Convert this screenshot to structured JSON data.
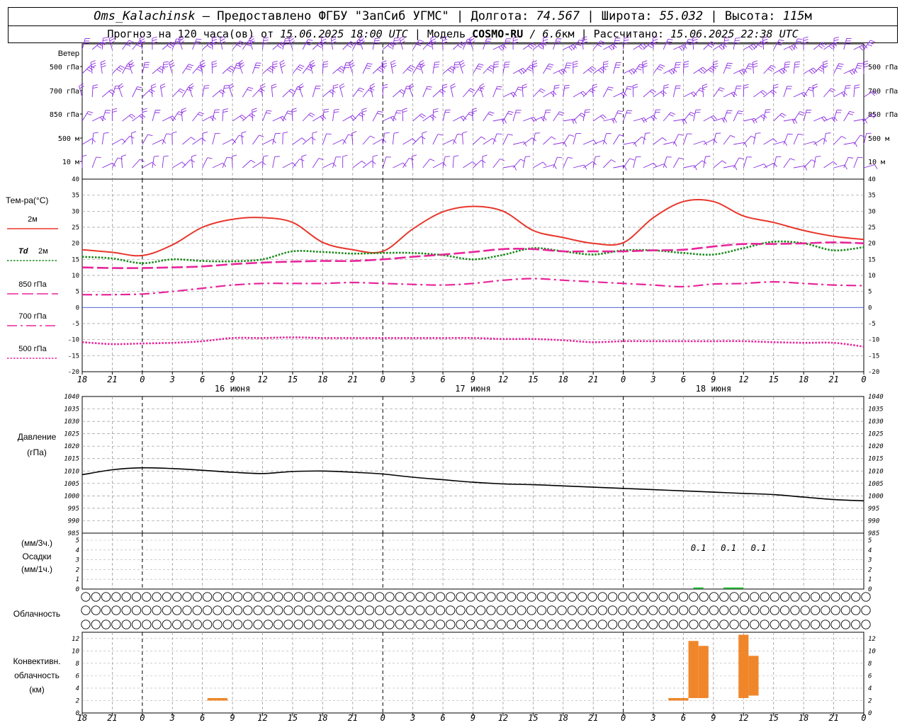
{
  "header": {
    "station": "Oms_Kalachinsk",
    "dash": " – ",
    "provider": "Предоставлено ФГБУ \"ЗапСиб УГМС\"",
    "sep": " | ",
    "lon_label": "Долгота:",
    "lon_value": "74.567",
    "lat_label": "Широта:",
    "lat_value": "55.032",
    "alt_label": "Высота:",
    "alt_value": "115",
    "alt_unit": "м",
    "forecast_prefix": "Прогноз на 120 часа(ов) от ",
    "forecast_from": "15.06.2025 18:00 UTC",
    "model_label": "| Модель ",
    "model_name": "COSMO-RU",
    "model_res": " / 6.6",
    "model_res_unit": "км",
    "calc_label": " | Рассчитано: ",
    "calc_time": "15.06.2025 22:38 UTC"
  },
  "chart_data": [
    {
      "type": "barbs",
      "title": "Ветер",
      "levels": [
        "500 гПа",
        "700 гПа",
        "850 гПа",
        "500 м",
        "10 м"
      ],
      "colors": {
        "barb": "#8a2be2"
      }
    },
    {
      "type": "line",
      "title": "Тем-ра(°C)",
      "ylim": [
        -20,
        40
      ],
      "yticks": [
        -20,
        -15,
        -10,
        -5,
        0,
        5,
        10,
        15,
        20,
        25,
        30,
        35,
        40
      ],
      "x_ticks": [
        "18",
        "21",
        "0",
        "3",
        "6",
        "9",
        "12",
        "15",
        "18",
        "21",
        "0",
        "3",
        "6",
        "9",
        "12",
        "15",
        "18",
        "21",
        "0",
        "3",
        "6",
        "9",
        "12",
        "15",
        "18",
        "21",
        "0"
      ],
      "day_labels": [
        "16 июня",
        "17 июня",
        "18 июня"
      ],
      "x_hours": [
        0,
        3,
        6,
        9,
        12,
        15,
        18,
        21,
        24,
        27,
        30,
        33,
        36,
        39,
        42,
        45,
        48,
        51,
        54,
        57,
        60,
        63,
        66,
        69,
        72,
        75,
        78
      ],
      "series": [
        {
          "name": "2м",
          "color": "#e8362b",
          "dash": "solid",
          "values": [
            18,
            17.2,
            16.2,
            19.5,
            25,
            27.5,
            28,
            26.5,
            20.3,
            18,
            17.5,
            24.5,
            29.8,
            31.5,
            30,
            24,
            21.8,
            20,
            20.2,
            28,
            33,
            33,
            28.5,
            26.5,
            24,
            22.2,
            21.2
          ]
        },
        {
          "name": "Td 2м",
          "color": "#1a8a1a",
          "dash": "dotted",
          "values": [
            15.8,
            15.3,
            13.8,
            15,
            14.5,
            14.4,
            15,
            17.5,
            17.3,
            16.8,
            17,
            17,
            16.3,
            15,
            16.4,
            18.5,
            17.5,
            16.5,
            17.8,
            17.8,
            17,
            16.5,
            18.5,
            20.5,
            20,
            17.8,
            18.8
          ]
        },
        {
          "name": "850 гПа",
          "color": "#e8259b",
          "dash": "longdash",
          "values": [
            12.5,
            12.3,
            12.3,
            12.5,
            12.8,
            13.5,
            14,
            14.3,
            14.5,
            14.5,
            15,
            15.8,
            16.5,
            17.3,
            18.2,
            18.2,
            17.5,
            17.5,
            17.5,
            17.8,
            18,
            19,
            19.8,
            19.8,
            20,
            20.3,
            20
          ]
        },
        {
          "name": "700 гПа",
          "color": "#e8259b",
          "dash": "dashdot",
          "values": [
            4,
            4,
            4.2,
            5,
            6,
            7,
            7.5,
            7.5,
            7.5,
            7.8,
            7.5,
            7.2,
            7,
            7.5,
            8.5,
            9,
            8.5,
            8,
            7.5,
            7,
            6.5,
            7.3,
            7.5,
            8,
            7.5,
            7,
            6.8
          ]
        },
        {
          "name": "500 гПа",
          "color": "#e8259b",
          "dash": "dotted",
          "values": [
            -10.8,
            -11.4,
            -11.2,
            -11,
            -10.5,
            -9.5,
            -9.5,
            -9.3,
            -9.5,
            -9.5,
            -9.5,
            -9.5,
            -9.5,
            -9.5,
            -9.8,
            -9.8,
            -10.2,
            -10.8,
            -10.5,
            -10.5,
            -10.5,
            -10.5,
            -10.5,
            -10.8,
            -11,
            -11,
            -12.2
          ]
        }
      ]
    },
    {
      "type": "line",
      "title": "Давление",
      "unit": "(гПа)",
      "ylim": [
        985,
        1040
      ],
      "yticks": [
        985,
        990,
        995,
        1000,
        1005,
        1010,
        1015,
        1020,
        1025,
        1030,
        1035,
        1040
      ],
      "x_hours": [
        0,
        3,
        6,
        9,
        12,
        15,
        18,
        21,
        24,
        27,
        30,
        33,
        36,
        39,
        42,
        45,
        48,
        51,
        54,
        57,
        60,
        63,
        66,
        69,
        72,
        75,
        78
      ],
      "series": [
        {
          "name": "",
          "color": "#000000",
          "dash": "solid",
          "values": [
            1008.5,
            1010.5,
            1011.3,
            1011,
            1010.3,
            1009.5,
            1009,
            1009.8,
            1010,
            1009.5,
            1008.8,
            1007.5,
            1006.5,
            1005.5,
            1004.8,
            1004.5,
            1004,
            1003.5,
            1003,
            1002.5,
            1002,
            1001.5,
            1001,
            1000.5,
            999.5,
            998.5,
            998
          ]
        }
      ]
    },
    {
      "type": "bar",
      "title_top": "(мм/3ч.)",
      "title": "Осадки",
      "title_bottom": "(мм/1ч.)",
      "ylim": [
        0,
        5
      ],
      "yticks": [
        0,
        1,
        2,
        3,
        4,
        5
      ],
      "annotations": [
        {
          "hour": 61.5,
          "text": "0.1"
        },
        {
          "hour": 64.5,
          "text": "0.1"
        },
        {
          "hour": 67.5,
          "text": "0.1"
        }
      ],
      "bars": [
        {
          "start": 61,
          "end": 62,
          "value": 0.1,
          "color": "#2ecc40"
        },
        {
          "start": 64,
          "end": 66,
          "value": 0.1,
          "color": "#2ecc40"
        }
      ]
    },
    {
      "type": "symbols",
      "title": "Облачность",
      "colors": {
        "symbol": "#000000"
      },
      "rows": [
        [
          0,
          0,
          0,
          0,
          0,
          0,
          0,
          0,
          0,
          0,
          0,
          0,
          0,
          0,
          0,
          0,
          0,
          0,
          0,
          0,
          0,
          0,
          0,
          0,
          0,
          0,
          0,
          0,
          0,
          0,
          0,
          0,
          0,
          0,
          0,
          0,
          0,
          0,
          0,
          0,
          0,
          0,
          0,
          0,
          0,
          0,
          0,
          0,
          0,
          0,
          0,
          0,
          0,
          0,
          0,
          0,
          0,
          0,
          0,
          0,
          0,
          0,
          0,
          0,
          0,
          0,
          0,
          0,
          0,
          0,
          0,
          0,
          0,
          0,
          0,
          0,
          0,
          0,
          0,
          0
        ],
        [
          0,
          0,
          0,
          0,
          0,
          0,
          0,
          0,
          0,
          0,
          0,
          0,
          0,
          0,
          0,
          0,
          0,
          0,
          0,
          0,
          0,
          0,
          0,
          0,
          0,
          0,
          0,
          0,
          0,
          0,
          0,
          0,
          0,
          0,
          0,
          0,
          0,
          0,
          0,
          0,
          0,
          0,
          0,
          0,
          0,
          0,
          0,
          0,
          0,
          0,
          0,
          0,
          0,
          0,
          0,
          0,
          0,
          0,
          0,
          0,
          0,
          0,
          0,
          0,
          0,
          0,
          0,
          0,
          0,
          0,
          0,
          0,
          0,
          0,
          0,
          0,
          0,
          0,
          0,
          0
        ],
        [
          0,
          0,
          0,
          0,
          0,
          0,
          0,
          0,
          0,
          0,
          0,
          0,
          0,
          0,
          0,
          0,
          0,
          0,
          0,
          0,
          0,
          0,
          0,
          0,
          0,
          0,
          0,
          0,
          0,
          0,
          0,
          0,
          0,
          0,
          0,
          0,
          0,
          0,
          0,
          0,
          0,
          0,
          0,
          0,
          0,
          0,
          0,
          0,
          0,
          0,
          0,
          0,
          0,
          0,
          0,
          0,
          0,
          0,
          0,
          0,
          0,
          0,
          0,
          0,
          0,
          0,
          0,
          0,
          0,
          0,
          0,
          0,
          0,
          0,
          0,
          0,
          0,
          0,
          0,
          0
        ]
      ]
    },
    {
      "type": "bar",
      "title": "Конвективн. облачность",
      "title_lines": [
        "Конвективн.",
        "облачность",
        "(км)"
      ],
      "ylim": [
        0,
        13
      ],
      "yticks": [
        0,
        2,
        4,
        6,
        8,
        10,
        12
      ],
      "colors": {
        "bar": "#f0862a"
      },
      "bars": [
        {
          "start": 12.5,
          "end": 14.5,
          "bottom": 2,
          "top": 2.4
        },
        {
          "start": 58.5,
          "end": 60.5,
          "bottom": 2,
          "top": 2.4
        },
        {
          "start": 60.5,
          "end": 61.5,
          "bottom": 2.4,
          "top": 11.6
        },
        {
          "start": 61.5,
          "end": 62.5,
          "bottom": 2.4,
          "top": 10.8
        },
        {
          "start": 65.5,
          "end": 66.5,
          "bottom": 2.4,
          "top": 12.6
        },
        {
          "start": 66.5,
          "end": 67.5,
          "bottom": 2.8,
          "top": 9.2
        }
      ]
    }
  ]
}
